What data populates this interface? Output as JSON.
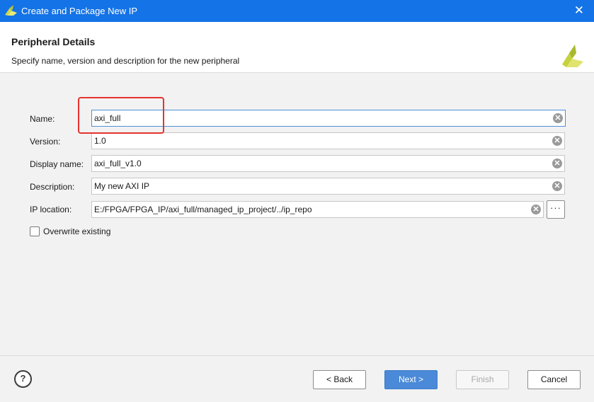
{
  "window": {
    "title": "Create and Package New IP",
    "close_glyph": "✕"
  },
  "header": {
    "title": "Peripheral Details",
    "subtitle": "Specify name, version and description for the new peripheral",
    "logo": "xilinx-logo-icon"
  },
  "form": {
    "fields": [
      {
        "label": "Name:",
        "value": "axi_full"
      },
      {
        "label": "Version:",
        "value": "1.0"
      },
      {
        "label": "Display name:",
        "value": "axi_full_v1.0"
      },
      {
        "label": "Description:",
        "value": "My new AXI IP"
      },
      {
        "label": "IP location:",
        "value": "E:/FPGA/FPGA_IP/axi_full/managed_ip_project/../ip_repo"
      }
    ],
    "clear_glyph": "✕",
    "browse_label": "···",
    "overwrite": {
      "label": "Overwrite existing",
      "checked": false
    }
  },
  "footer": {
    "help": "?",
    "back": "< Back",
    "next": "Next >",
    "finish": "Finish",
    "cancel": "Cancel"
  },
  "colors": {
    "titlebar": "#1473e6",
    "primary": "#4a8ad8",
    "annotation": "#e5322d"
  }
}
